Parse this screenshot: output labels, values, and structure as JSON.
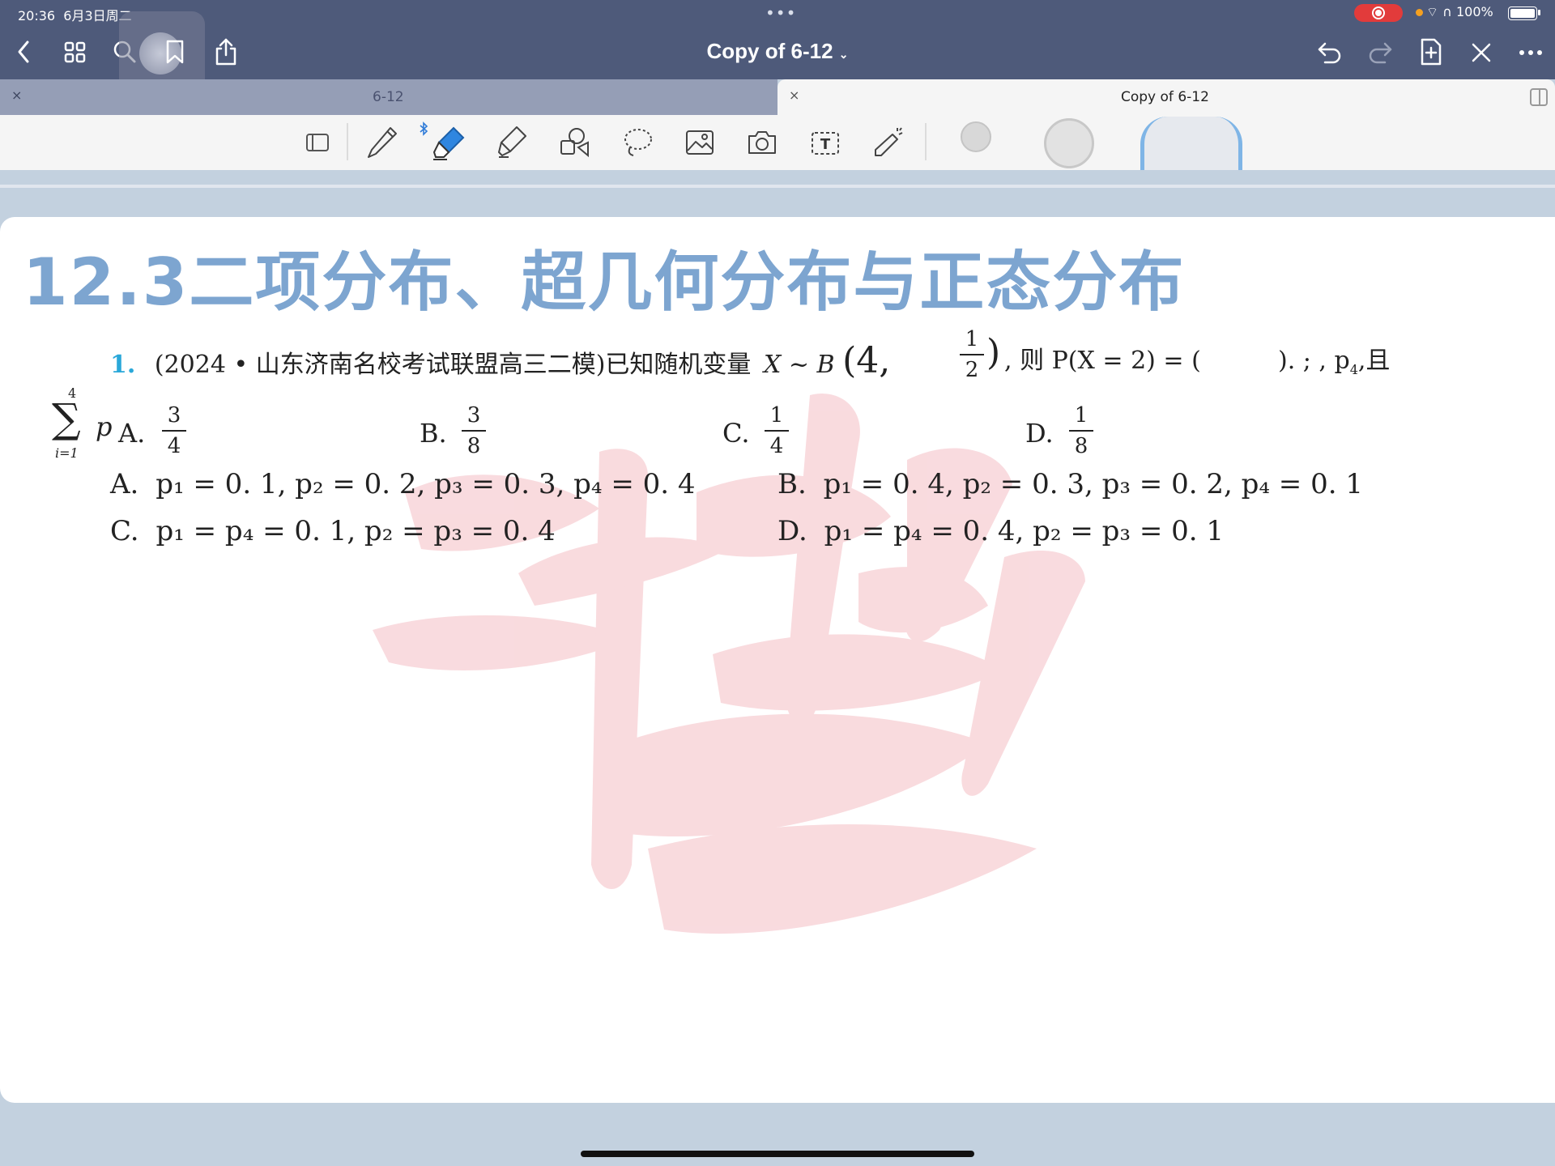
{
  "status": {
    "time": "20:36",
    "date": "6月3日周二",
    "center_dots": "•••",
    "battery": "100%"
  },
  "doc": {
    "title": "Copy of 6-12"
  },
  "tabs": [
    {
      "label": "6-12",
      "close": "×"
    },
    {
      "label": "Copy of 6-12",
      "close": "×"
    }
  ],
  "toolbar": {
    "bluetooth_icon": "bluetooth-icon",
    "text_tool_letter": "T"
  },
  "page": {
    "heading": "12.3二项分布、超几何分布与正态分布",
    "question": {
      "number": "1.",
      "source": "(2024 • 山东济南名校考试联盟高三二模)已知随机变量",
      "expr_head": "X ~ B",
      "expr_open": "(4,",
      "frac_half": {
        "num": "1",
        "den": "2"
      },
      "expr_close": ")",
      "tail": ", 则 P(X = 2) = (",
      "tail2": "). ; , p",
      "tail2_sub": "4",
      "tail3": ",且"
    },
    "sum": {
      "upper": "4",
      "lower": "i=1",
      "sym": "∑",
      "p": "p"
    },
    "choices": [
      {
        "label": "A.",
        "num": "3",
        "den": "4"
      },
      {
        "label": "B.",
        "num": "3",
        "den": "8"
      },
      {
        "label": "C.",
        "num": "1",
        "den": "4"
      },
      {
        "label": "D.",
        "num": "1",
        "den": "8"
      }
    ],
    "options": [
      {
        "label": "A.",
        "text": "p₁ = 0. 1, p₂ = 0. 2, p₃ = 0. 3, p₄ = 0. 4"
      },
      {
        "label": "B.",
        "text": "p₁ = 0. 4, p₂ = 0. 3, p₃ = 0. 2, p₄ = 0. 1"
      },
      {
        "label": "C.",
        "text": "p₁ = p₄ = 0. 1, p₂ = p₃ = 0. 4"
      },
      {
        "label": "D.",
        "text": "p₁ = p₄ = 0. 4, p₂ = p₃ = 0. 1"
      }
    ]
  }
}
